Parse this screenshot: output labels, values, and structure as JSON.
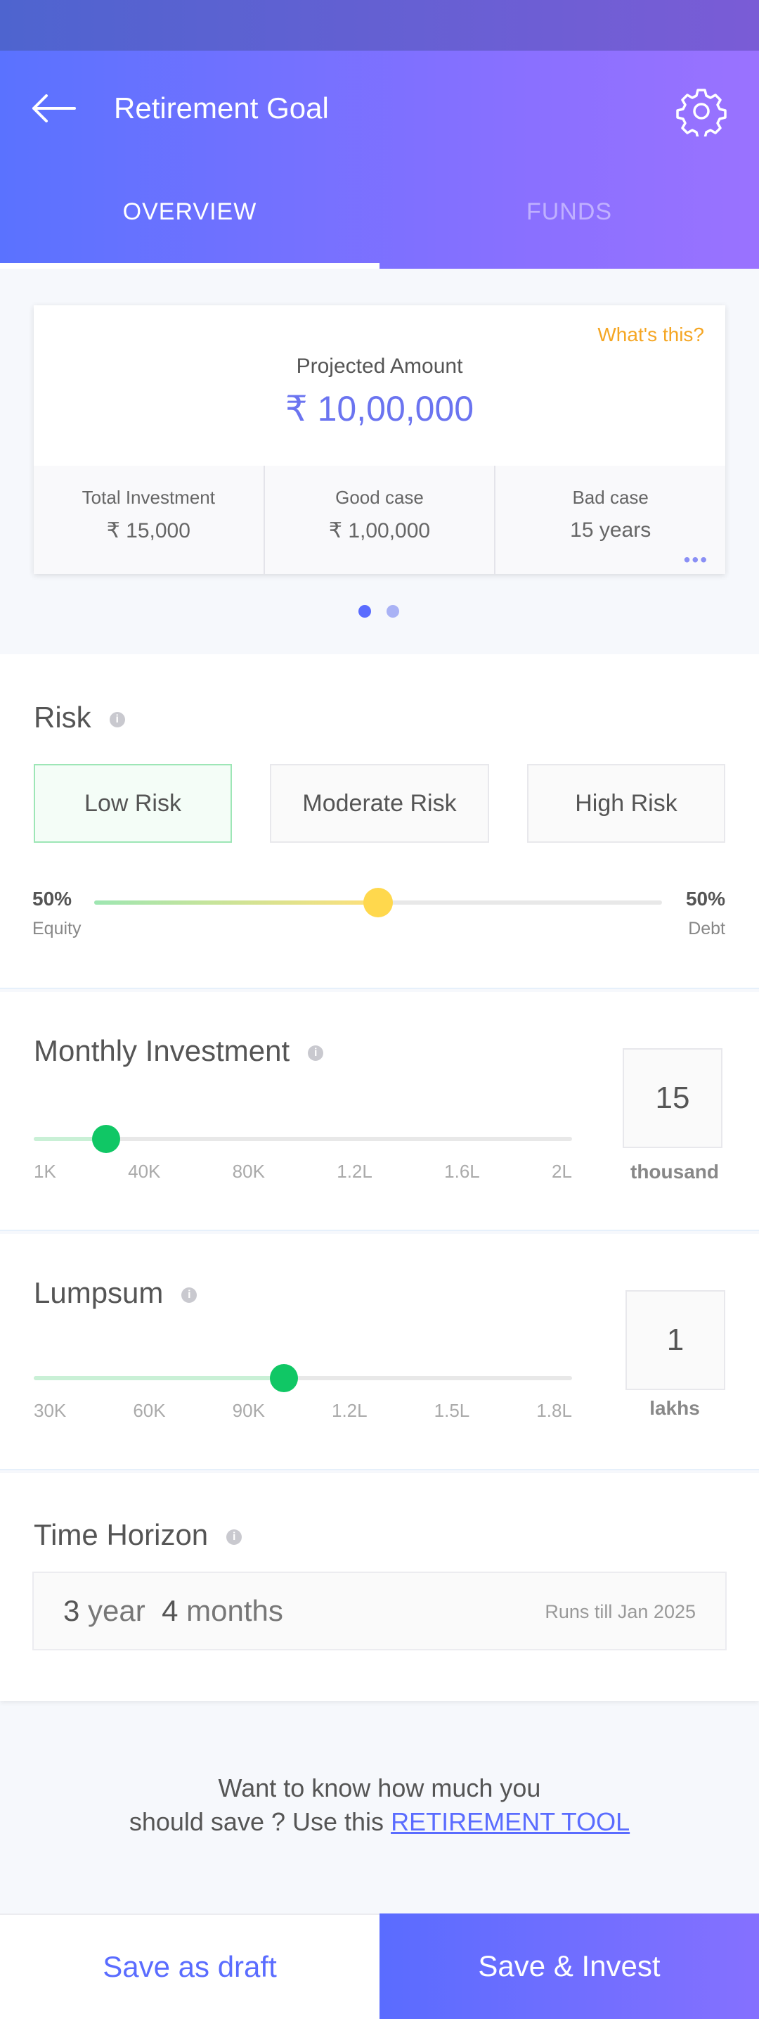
{
  "header": {
    "title": "Retirement Goal",
    "tabs": [
      {
        "label": "OVERVIEW",
        "active": true
      },
      {
        "label": "FUNDS",
        "active": false
      }
    ]
  },
  "card": {
    "help_link": "What's this?",
    "projected_label": "Projected Amount",
    "projected_value": "₹ 10,00,000",
    "stats": [
      {
        "label": "Total Investment",
        "value": "₹ 15,000"
      },
      {
        "label": "Good case",
        "value": "₹ 1,00,000"
      },
      {
        "label": "Bad case",
        "value": "15 years"
      }
    ],
    "more": "•••",
    "pager": {
      "current": 1,
      "total": 2
    }
  },
  "risk": {
    "title": "Risk",
    "options": [
      "Low Risk",
      "Moderate Risk",
      "High Risk"
    ],
    "selected": "Low Risk",
    "equity_pct": "50%",
    "equity_label": "Equity",
    "debt_pct": "50%",
    "debt_label": "Debt",
    "split_fraction": 0.5
  },
  "monthly": {
    "title": "Monthly Investment",
    "ticks": [
      "1K",
      "40K",
      "80K",
      "1.2L",
      "1.6L",
      "2L"
    ],
    "value": "15",
    "unit": "thousand",
    "fraction": 0.135
  },
  "lumpsum": {
    "title": "Lumpsum",
    "ticks": [
      "30K",
      "60K",
      "90K",
      "1.2L",
      "1.5L",
      "1.8L"
    ],
    "value": "1",
    "unit": "lakhs",
    "fraction": 0.465
  },
  "time_horizon": {
    "title": "Time Horizon",
    "years": "3",
    "years_unit": "year",
    "months": "4",
    "months_unit": "months",
    "note": "Runs till Jan 2025"
  },
  "promo": {
    "line1": "Want to know how much you",
    "line2": "should save ? Use this",
    "link": "RETIREMENT TOOL"
  },
  "footer": {
    "draft_label": "Save as draft",
    "invest_label": "Save & Invest"
  },
  "colors": {
    "accent": "#5a6cff",
    "accent_purple": "#8a70ff",
    "orange": "#f5a623",
    "green": "#10c765",
    "yellow": "#ffd84d"
  }
}
